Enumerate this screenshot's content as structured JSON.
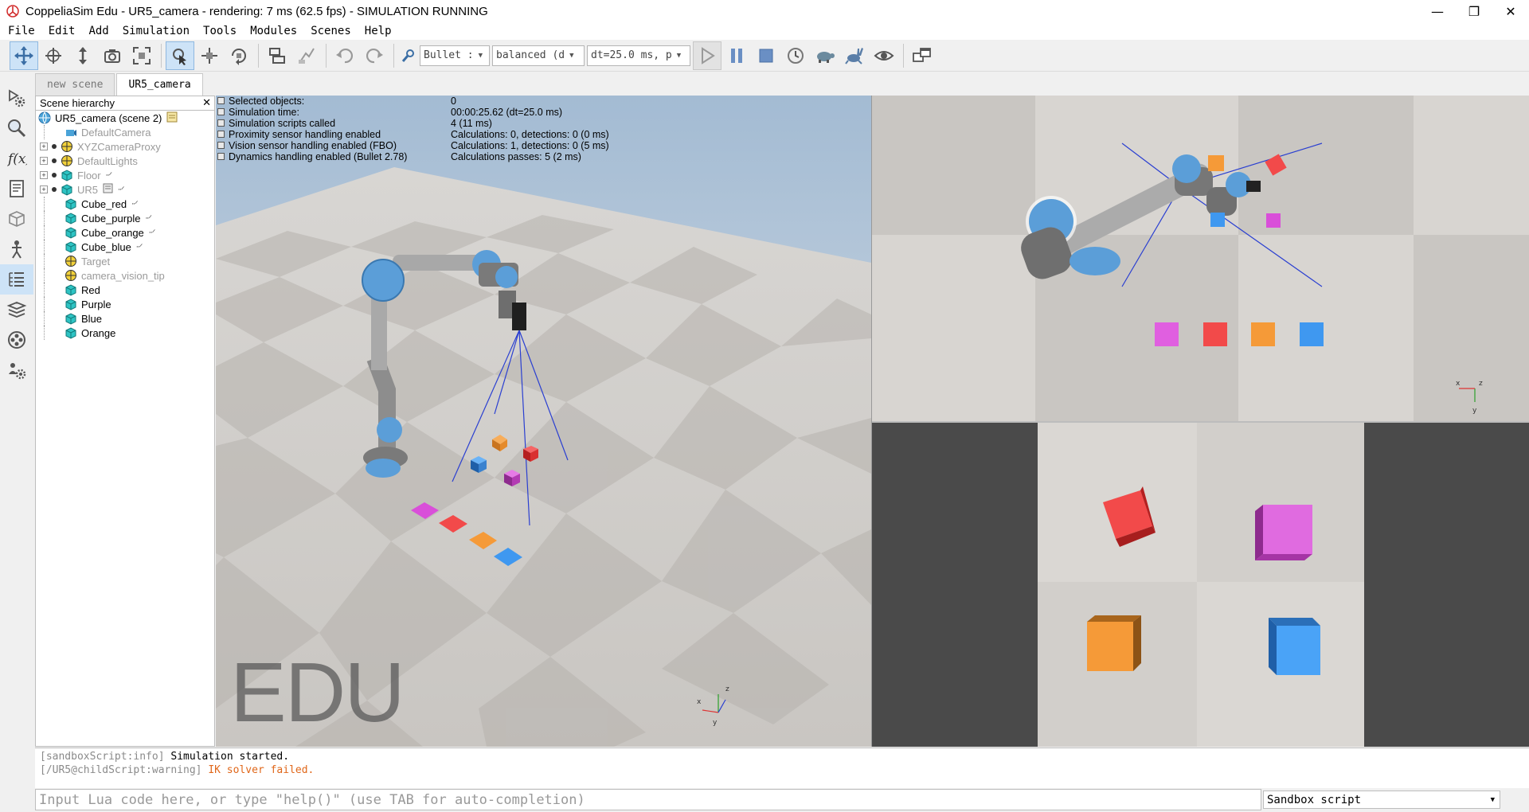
{
  "window": {
    "title": "CoppeliaSim Edu - UR5_camera - rendering: 7 ms (62.5 fps) - SIMULATION RUNNING",
    "minimize": "—",
    "restore": "❐",
    "close": "✕"
  },
  "menu": [
    "File",
    "Edit",
    "Add",
    "Simulation",
    "Tools",
    "Modules",
    "Scenes",
    "Help"
  ],
  "toolbar": {
    "engine": "Bullet :",
    "accuracy": "balanced (d",
    "timestep": "dt=25.0 ms, p"
  },
  "tabs": [
    "new scene",
    "UR5_camera"
  ],
  "hierarchy": {
    "title": "Scene hierarchy",
    "root": "UR5_camera (scene 2)",
    "items": [
      {
        "label": "DefaultCamera",
        "dim": true
      },
      {
        "label": "XYZCameraProxy",
        "dim": true
      },
      {
        "label": "DefaultLights",
        "dim": true
      },
      {
        "label": "Floor",
        "dim": true
      },
      {
        "label": "UR5",
        "dim": true
      },
      {
        "label": "Cube_red",
        "dim": false
      },
      {
        "label": "Cube_purple",
        "dim": false
      },
      {
        "label": "Cube_orange",
        "dim": false
      },
      {
        "label": "Cube_blue",
        "dim": false
      },
      {
        "label": "Target",
        "dim": true
      },
      {
        "label": "camera_vision_tip",
        "dim": true
      },
      {
        "label": "Red",
        "dim": false
      },
      {
        "label": "Purple",
        "dim": false
      },
      {
        "label": "Blue",
        "dim": false
      },
      {
        "label": "Orange",
        "dim": false
      }
    ]
  },
  "info": {
    "rows": [
      {
        "k": "Selected objects:",
        "v": "0"
      },
      {
        "k": "Simulation time:",
        "v": "00:00:25.62 (dt=25.0 ms)"
      },
      {
        "k": "Simulation scripts called",
        "v": "4 (11 ms)"
      },
      {
        "k": "Proximity sensor handling enabled",
        "v": "Calculations: 0, detections: 0 (0 ms)"
      },
      {
        "k": "Vision sensor handling enabled (FBO)",
        "v": "Calculations: 1, detections: 0 (5 ms)"
      },
      {
        "k": "Dynamics handling enabled (Bullet 2.78)",
        "v": "Calculations passes: 5 (2 ms)"
      }
    ]
  },
  "watermark": "EDU",
  "console": {
    "line1_prefix": "[sandboxScript:info]",
    "line1_msg": "Simulation started.",
    "line2_prefix": "[/UR5@childScript:warning]",
    "line2_msg": "IK solver failed."
  },
  "input": {
    "placeholder": "Input Lua code here, or type \"help()\" (use TAB for auto-completion)"
  },
  "script_select": "Sandbox script",
  "colors": {
    "cube_red": "#f24a4a",
    "cube_purple": "#d94fd9",
    "cube_orange": "#f59a38",
    "cube_blue": "#3f98f0",
    "sky_top": "#a7bfd6"
  }
}
